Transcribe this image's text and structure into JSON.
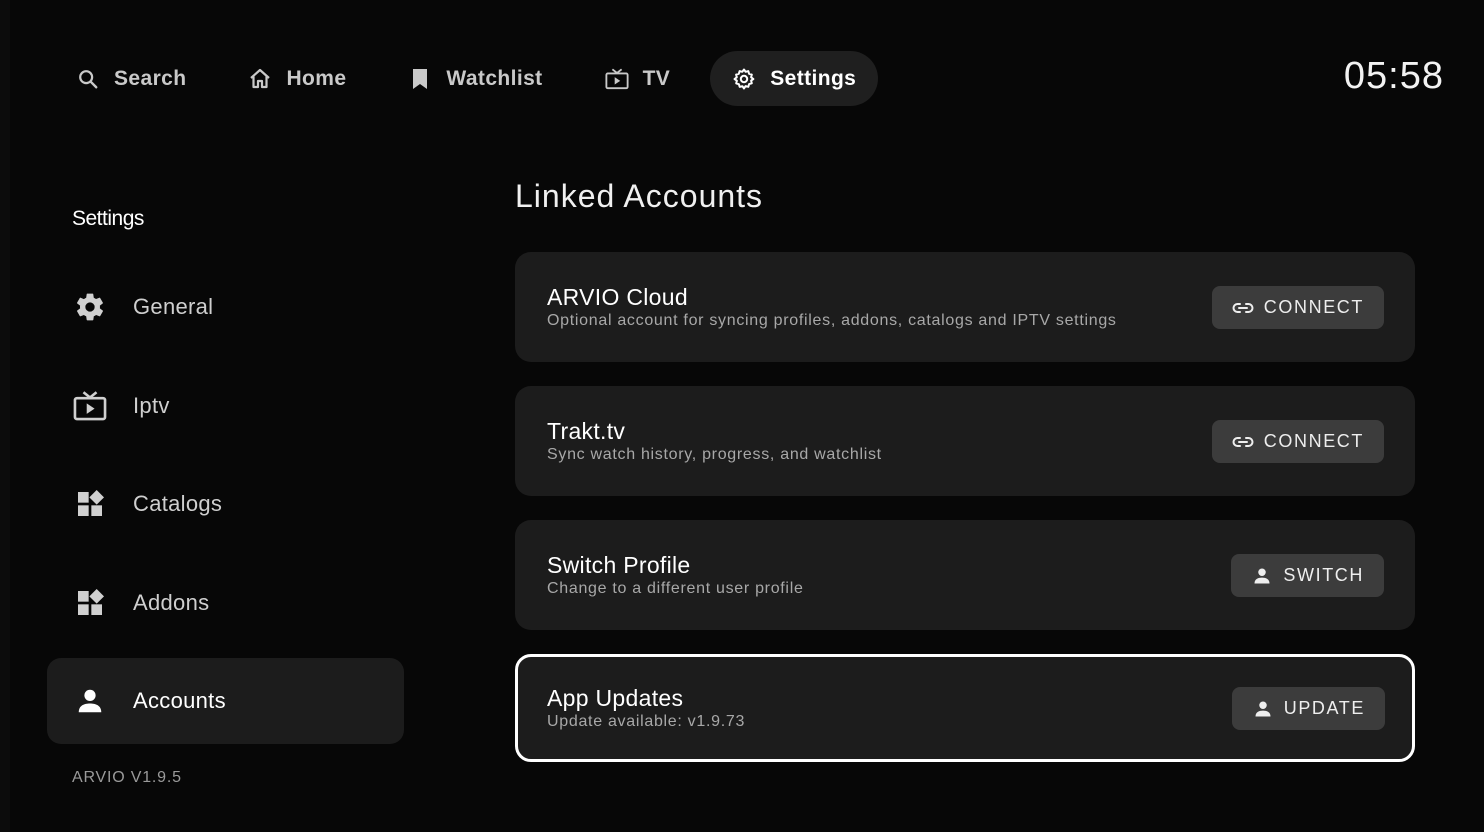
{
  "topnav": {
    "items": [
      {
        "label": "Search",
        "icon": "search-icon"
      },
      {
        "label": "Home",
        "icon": "home-icon"
      },
      {
        "label": "Watchlist",
        "icon": "bookmark-icon"
      },
      {
        "label": "TV",
        "icon": "tv-icon"
      },
      {
        "label": "Settings",
        "icon": "gear-icon",
        "active": true
      }
    ],
    "clock": "05:58"
  },
  "sidebar": {
    "title": "Settings",
    "items": [
      {
        "label": "General",
        "icon": "gear-icon"
      },
      {
        "label": "Iptv",
        "icon": "tv-play-icon"
      },
      {
        "label": "Catalogs",
        "icon": "widgets-icon"
      },
      {
        "label": "Addons",
        "icon": "widgets-icon"
      },
      {
        "label": "Accounts",
        "icon": "person-icon",
        "active": true
      }
    ],
    "version": "ARVIO V1.9.5"
  },
  "main": {
    "title": "Linked Accounts",
    "cards": [
      {
        "title": "ARVIO Cloud",
        "subtitle": "Optional account for syncing profiles, addons, catalogs and IPTV settings",
        "button": "CONNECT",
        "button_icon": "link-icon"
      },
      {
        "title": "Trakt.tv",
        "subtitle": "Sync watch history, progress, and watchlist",
        "button": "CONNECT",
        "button_icon": "link-icon"
      },
      {
        "title": "Switch Profile",
        "subtitle": "Change to a different user profile",
        "button": "SWITCH",
        "button_icon": "person-icon"
      },
      {
        "title": "App Updates",
        "subtitle": "Update available: v1.9.73",
        "button": "UPDATE",
        "button_icon": "person-icon",
        "focused": true
      }
    ]
  },
  "colors": {
    "background": "#070707",
    "card": "#1c1c1c",
    "button": "#3c3c3c",
    "focus_border": "#ffffff",
    "muted_text": "#a8a8a8"
  }
}
